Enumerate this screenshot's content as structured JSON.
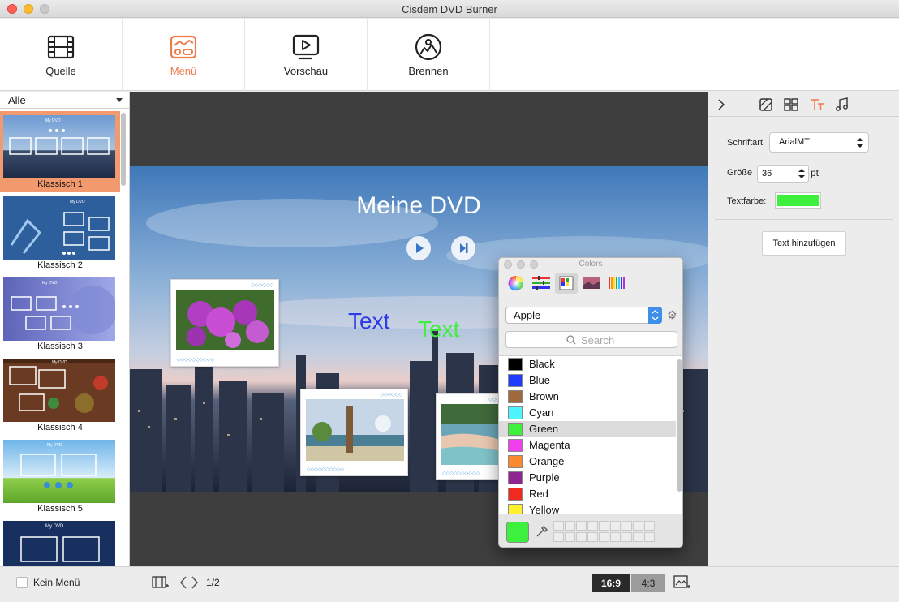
{
  "window": {
    "title": "Cisdem DVD Burner"
  },
  "toolbar": [
    {
      "label": "Quelle",
      "icon": "film-icon",
      "active": false
    },
    {
      "label": "Menü",
      "icon": "menu-layout-icon",
      "active": true
    },
    {
      "label": "Vorschau",
      "icon": "play-screen-icon",
      "active": false
    },
    {
      "label": "Brennen",
      "icon": "burn-disc-icon",
      "active": false
    }
  ],
  "sidebar": {
    "filter_value": "Alle",
    "themes": [
      {
        "name": "Klassisch 1",
        "caption": "My DVD",
        "selected": true
      },
      {
        "name": "Klassisch 2",
        "caption": "My DVD",
        "selected": false
      },
      {
        "name": "Klassisch 3",
        "caption": "My DVD",
        "selected": false
      },
      {
        "name": "Klassisch 4",
        "caption": "My DVD",
        "selected": false
      },
      {
        "name": "Klassisch 5",
        "caption": "My DVD",
        "selected": false
      },
      {
        "name": "",
        "caption": "My DVD",
        "selected": false
      }
    ]
  },
  "canvas": {
    "title": "Meine DVD",
    "text_items": [
      {
        "text": "Text",
        "color": "#2c3be6"
      },
      {
        "text": "Text",
        "color": "#3ef03e"
      }
    ]
  },
  "colors_panel": {
    "title": "Colors",
    "palette": "Apple",
    "search_placeholder": "Search",
    "items": [
      {
        "name": "Black",
        "hex": "#000000",
        "selected": false
      },
      {
        "name": "Blue",
        "hex": "#1f3cff",
        "selected": false
      },
      {
        "name": "Brown",
        "hex": "#a0693c",
        "selected": false
      },
      {
        "name": "Cyan",
        "hex": "#4cf5ff",
        "selected": false
      },
      {
        "name": "Green",
        "hex": "#3ef03e",
        "selected": true
      },
      {
        "name": "Magenta",
        "hex": "#f040ee",
        "selected": false
      },
      {
        "name": "Orange",
        "hex": "#fb8a2e",
        "selected": false
      },
      {
        "name": "Purple",
        "hex": "#8e2591",
        "selected": false
      },
      {
        "name": "Red",
        "hex": "#f02a1f",
        "selected": false
      },
      {
        "name": "Yellow",
        "hex": "#fff02e",
        "selected": false
      }
    ],
    "current_color": "#3ef03e"
  },
  "inspector": {
    "font_label": "Schriftart",
    "font_value": "ArialMT",
    "size_label": "Größe",
    "size_value": "36",
    "size_unit": "pt",
    "color_label": "Textfarbe:",
    "color_value": "#3ef03e",
    "add_text_label": "Text hinzufügen"
  },
  "bottombar": {
    "no_menu_label": "Kein Menü",
    "page_indicator": "1/2",
    "ratio_169": "16:9",
    "ratio_43": "4:3"
  },
  "colors": {
    "accent": "#ee7b4a",
    "selected_theme_bg": "#f29a6e"
  }
}
